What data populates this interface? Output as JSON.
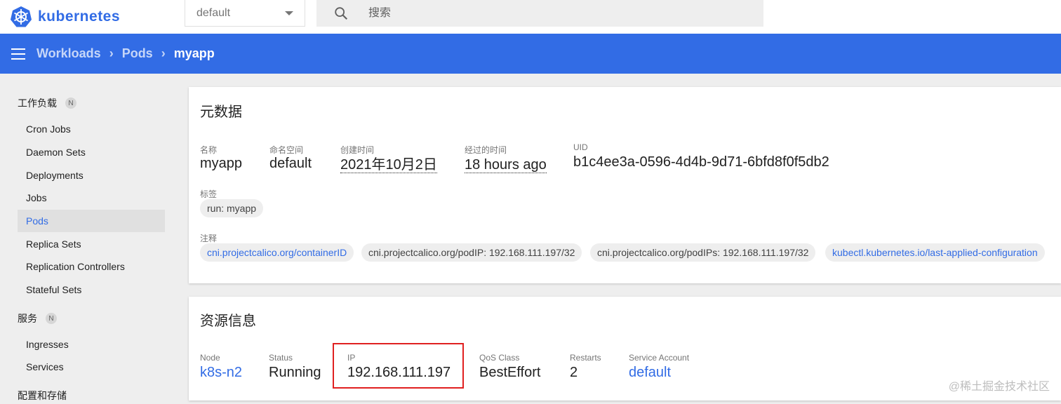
{
  "brand": {
    "name": "kubernetes",
    "color": "#326ce5"
  },
  "topbar": {
    "namespace": "default",
    "search_placeholder": "搜索"
  },
  "breadcrumbs": {
    "items": [
      "Workloads",
      "Pods"
    ],
    "current": "myapp"
  },
  "sidebar": {
    "sections": [
      {
        "title": "工作负载",
        "badge": "N",
        "items": [
          "Cron Jobs",
          "Daemon Sets",
          "Deployments",
          "Jobs",
          "Pods",
          "Replica Sets",
          "Replication Controllers",
          "Stateful Sets"
        ]
      },
      {
        "title": "服务",
        "badge": "N",
        "items": [
          "Ingresses",
          "Services"
        ]
      },
      {
        "title": "配置和存储"
      }
    ],
    "active_item": "Pods"
  },
  "metadata": {
    "title": "元数据",
    "fields": [
      {
        "label": "名称",
        "value": "myapp"
      },
      {
        "label": "命名空间",
        "value": "default"
      },
      {
        "label": "创建时间",
        "value": "2021年10月2日"
      },
      {
        "label": "经过的时间",
        "value": "18 hours ago"
      },
      {
        "label": "UID",
        "value": "b1c4ee3a-0596-4d4b-9d71-6bfd8f0f5db2"
      }
    ],
    "labels_title": "标签",
    "labels": [
      "run: myapp"
    ],
    "annotations_title": "注释",
    "annotations": [
      "cni.projectcalico.org/containerID",
      "cni.projectcalico.org/podIP: 192.168.111.197/32",
      "cni.projectcalico.org/podIPs: 192.168.111.197/32",
      "kubectl.kubernetes.io/last-applied-configuration"
    ]
  },
  "resource": {
    "title": "资源信息",
    "fields": [
      {
        "label": "Node",
        "value": "k8s-n2"
      },
      {
        "label": "Status",
        "value": "Running"
      },
      {
        "label": "IP",
        "value": "192.168.111.197"
      },
      {
        "label": "QoS Class",
        "value": "BestEffort"
      },
      {
        "label": "Restarts",
        "value": "2"
      },
      {
        "label": "Service Account",
        "value": "default"
      }
    ]
  },
  "watermark": "@稀土掘金技术社区"
}
